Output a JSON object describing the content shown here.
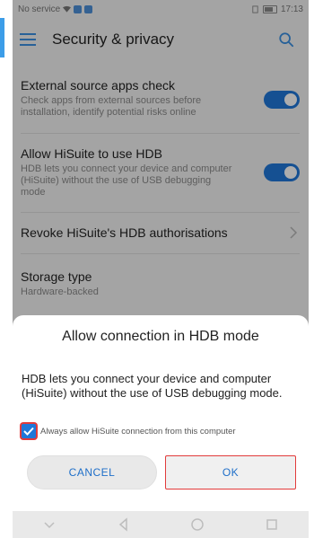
{
  "status_bar": {
    "carrier": "No service",
    "time": "17:13"
  },
  "header": {
    "title": "Security & privacy"
  },
  "settings": [
    {
      "title": "External source apps check",
      "description": "Check apps from external sources before installation, identify potential risks online",
      "toggle": "on"
    },
    {
      "title": "Allow HiSuite to use HDB",
      "description": "HDB lets you connect your device and computer (HiSuite) without the use of USB debugging mode",
      "toggle": "on"
    },
    {
      "title": "Revoke HiSuite's HDB authorisations"
    },
    {
      "title": "Storage type",
      "description": "Hardware-backed"
    }
  ],
  "dialog": {
    "title": "Allow connection in HDB mode",
    "message": "HDB lets you connect your device and computer (HiSuite) without the use of USB debugging mode.",
    "checkbox_label": "Always allow HiSuite connection from this computer",
    "checkbox_checked": true,
    "cancel_label": "CANCEL",
    "ok_label": "OK"
  },
  "colors": {
    "accent": "#1f77d8",
    "highlight_outline": "#e23b3b"
  }
}
